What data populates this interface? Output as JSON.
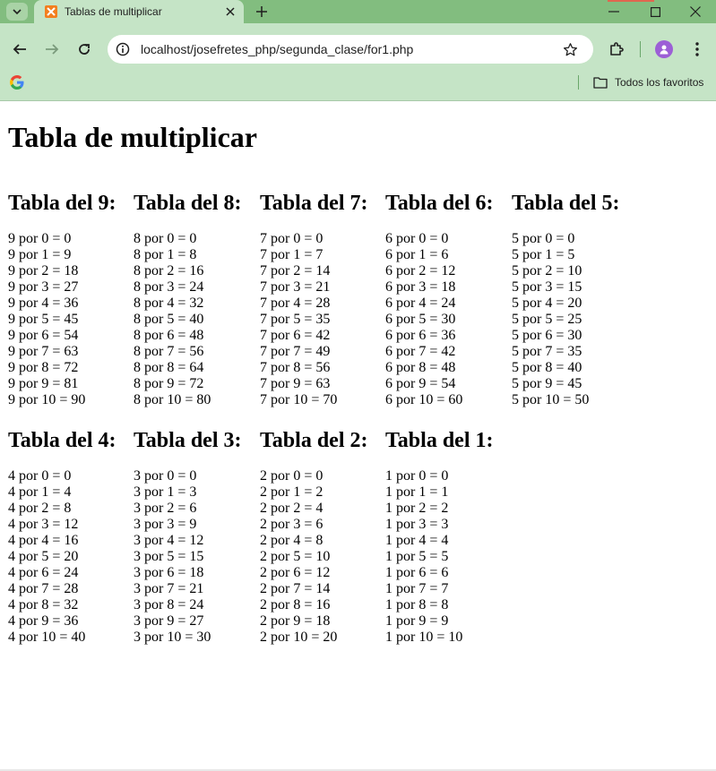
{
  "browser": {
    "tab_title": "Tablas de multiplicar",
    "url": "localhost/josefretes_php/segunda_clase/for1.php",
    "bookmarks_all_label": "Todos los favoritos",
    "colors": {
      "tabstrip": "#82bd7f",
      "toolbar": "#c5e4c6",
      "accent": "#e0664f",
      "favicon": "#f37f1f",
      "avatar": "#9c5fd6"
    },
    "icons": [
      "tab-search-icon",
      "xampp-favicon",
      "close-icon",
      "plus-icon",
      "minimize-icon",
      "maximize-icon",
      "window-close-icon",
      "back-arrow-icon",
      "forward-arrow-icon",
      "reload-icon",
      "site-info-icon",
      "star-icon",
      "extensions-icon",
      "avatar-icon",
      "menu-dots-icon",
      "google-icon",
      "folder-icon"
    ]
  },
  "page": {
    "title": "Tabla de multiplicar",
    "tables": [
      {
        "heading": "Tabla del 9:",
        "lines": [
          "9 por 0 = 0",
          "9 por 1 = 9",
          "9 por 2 = 18",
          "9 por 3 = 27",
          "9 por 4 = 36",
          "9 por 5 = 45",
          "9 por 6 = 54",
          "9 por 7 = 63",
          "9 por 8 = 72",
          "9 por 9 = 81",
          "9 por 10 = 90"
        ]
      },
      {
        "heading": "Tabla del 8:",
        "lines": [
          "8 por 0 = 0",
          "8 por 1 = 8",
          "8 por 2 = 16",
          "8 por 3 = 24",
          "8 por 4 = 32",
          "8 por 5 = 40",
          "8 por 6 = 48",
          "8 por 7 = 56",
          "8 por 8 = 64",
          "8 por 9 = 72",
          "8 por 10 = 80"
        ]
      },
      {
        "heading": "Tabla del 7:",
        "lines": [
          "7 por 0 = 0",
          "7 por 1 = 7",
          "7 por 2 = 14",
          "7 por 3 = 21",
          "7 por 4 = 28",
          "7 por 5 = 35",
          "7 por 6 = 42",
          "7 por 7 = 49",
          "7 por 8 = 56",
          "7 por 9 = 63",
          "7 por 10 = 70"
        ]
      },
      {
        "heading": "Tabla del 6:",
        "lines": [
          "6 por 0 = 0",
          "6 por 1 = 6",
          "6 por 2 = 12",
          "6 por 3 = 18",
          "6 por 4 = 24",
          "6 por 5 = 30",
          "6 por 6 = 36",
          "6 por 7 = 42",
          "6 por 8 = 48",
          "6 por 9 = 54",
          "6 por 10 = 60"
        ]
      },
      {
        "heading": "Tabla del 5:",
        "lines": [
          "5 por 0 = 0",
          "5 por 1 = 5",
          "5 por 2 = 10",
          "5 por 3 = 15",
          "5 por 4 = 20",
          "5 por 5 = 25",
          "5 por 6 = 30",
          "5 por 7 = 35",
          "5 por 8 = 40",
          "5 por 9 = 45",
          "5 por 10 = 50"
        ]
      },
      {
        "heading": "Tabla del 4:",
        "lines": [
          "4 por 0 = 0",
          "4 por 1 = 4",
          "4 por 2 = 8",
          "4 por 3 = 12",
          "4 por 4 = 16",
          "4 por 5 = 20",
          "4 por 6 = 24",
          "4 por 7 = 28",
          "4 por 8 = 32",
          "4 por 9 = 36",
          "4 por 10 = 40"
        ]
      },
      {
        "heading": "Tabla del 3:",
        "lines": [
          "3 por 0 = 0",
          "3 por 1 = 3",
          "3 por 2 = 6",
          "3 por 3 = 9",
          "3 por 4 = 12",
          "3 por 5 = 15",
          "3 por 6 = 18",
          "3 por 7 = 21",
          "3 por 8 = 24",
          "3 por 9 = 27",
          "3 por 10 = 30"
        ]
      },
      {
        "heading": "Tabla del 2:",
        "lines": [
          "2 por 0 = 0",
          "2 por 1 = 2",
          "2 por 2 = 4",
          "2 por 3 = 6",
          "2 por 4 = 8",
          "2 por 5 = 10",
          "2 por 6 = 12",
          "2 por 7 = 14",
          "2 por 8 = 16",
          "2 por 9 = 18",
          "2 por 10 = 20"
        ]
      },
      {
        "heading": "Tabla del 1:",
        "lines": [
          "1 por 0 = 0",
          "1 por 1 = 1",
          "1 por 2 = 2",
          "1 por 3 = 3",
          "1 por 4 = 4",
          "1 por 5 = 5",
          "1 por 6 = 6",
          "1 por 7 = 7",
          "1 por 8 = 8",
          "1 por 9 = 9",
          "1 por 10 = 10"
        ]
      }
    ]
  }
}
